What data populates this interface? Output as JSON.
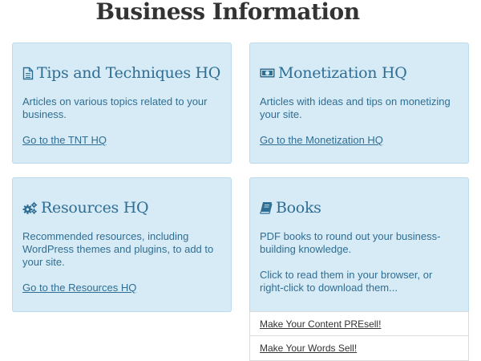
{
  "page": {
    "title": "Business Information"
  },
  "cards": {
    "tnt": {
      "title": "Tips and Techniques HQ",
      "icon": "document-icon",
      "description": "Articles on various topics related to your business.",
      "link": "Go to the TNT HQ"
    },
    "monetization": {
      "title": "Monetization HQ",
      "icon": "money-icon",
      "description": "Articles with ideas and tips on monetizing your site.",
      "link": "Go to the Monetization HQ"
    },
    "resources": {
      "title": "Resources HQ",
      "icon": "gears-icon",
      "description": "Recommended resources, including WordPress themes and plugins, to add to your site.",
      "link": "Go to the Resources HQ"
    },
    "books": {
      "title": "Books",
      "icon": "book-icon",
      "description": "PDF books to round out your business-building knowledge.",
      "instructions": "Click to read them in your browser, or right-click to download them...",
      "items": [
        "Make Your Content PREsell!",
        "Make Your Words Sell!"
      ]
    }
  },
  "colors": {
    "card_background": "#d7ebf6",
    "card_border": "#b9dbed",
    "accent_text": "#2f6e93",
    "title_text": "#333333"
  }
}
